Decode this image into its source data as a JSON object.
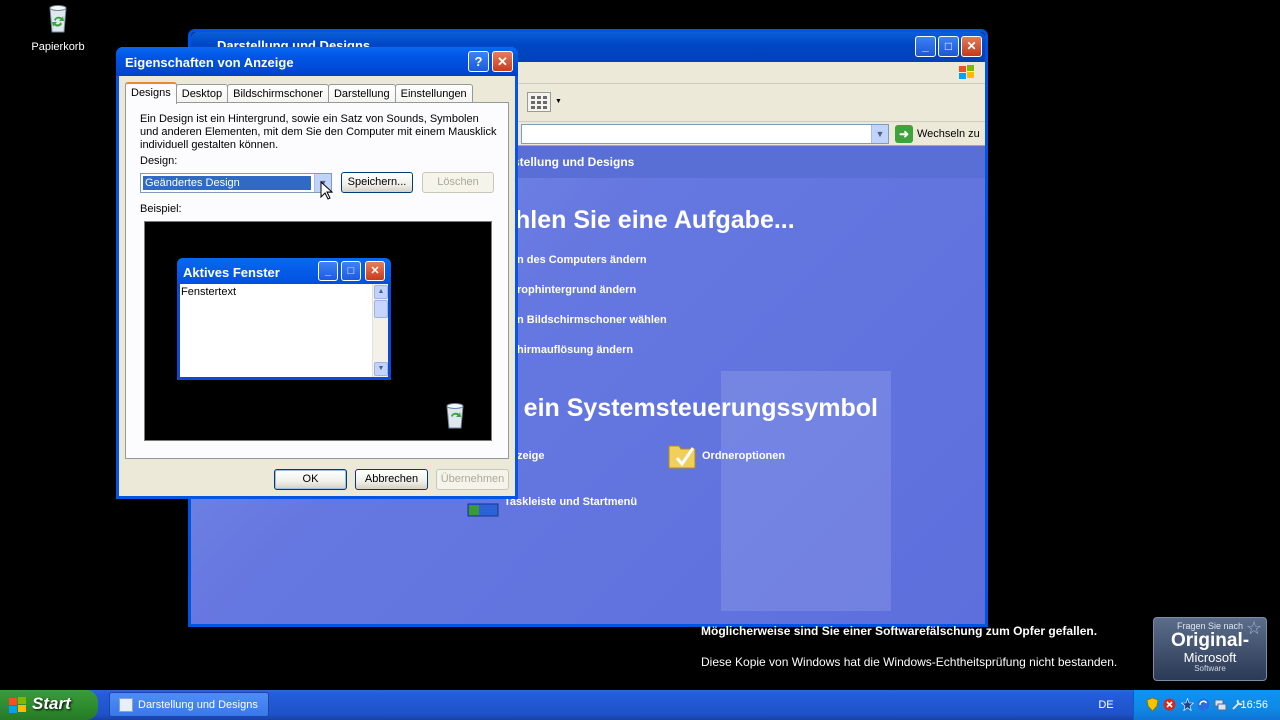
{
  "desktop": {
    "icons": [
      {
        "label": "Papierkorb",
        "icon": "recycle-bin-icon"
      }
    ]
  },
  "control_panel": {
    "title": "Darstellung und Designs",
    "address_go": "Wechseln zu",
    "breadcrumb": "stellung und Designs",
    "heading_tasks": "hlen Sie eine Aufgabe...",
    "tasks": [
      "n des Computers ändern",
      "rophintergrund ändern",
      "n Bildschirmschoner wählen",
      "hirmauflösung ändern"
    ],
    "heading_icons": "r ein Systemsteuerungssymbol",
    "icon_links": [
      "zeige",
      "Ordneroptionen",
      "Taskleiste und Startmenü"
    ]
  },
  "dialog": {
    "title": "Eigenschaften von Anzeige",
    "tabs": [
      "Designs",
      "Desktop",
      "Bildschirmschoner",
      "Darstellung",
      "Einstellungen"
    ],
    "active_tab": "Designs",
    "description": "Ein Design ist ein Hintergrund, sowie ein Satz von Sounds, Symbolen und anderen Elementen, mit dem Sie den Computer mit einem Mausklick individuell gestalten können.",
    "design_label": "Design:",
    "design_value": "Geändertes Design",
    "save_button": "Speichern...",
    "delete_button": "Löschen",
    "sample_label": "Beispiel:",
    "preview_window_title": "Aktives Fenster",
    "preview_window_text": "Fenstertext",
    "ok_button": "OK",
    "cancel_button": "Abbrechen",
    "apply_button": "Übernehmen"
  },
  "activation": {
    "line1": "Möglicherweise sind Sie einer Softwarefälschung zum Opfer gefallen.",
    "line2": "Diese Kopie von Windows hat die Windows-Echtheitsprüfung nicht bestanden.",
    "badge_line1": "Fragen Sie nach",
    "badge_line2": "Original-",
    "badge_line3": "Microsoft",
    "badge_line4": "Software"
  },
  "taskbar": {
    "start_label": "Start",
    "task_button": "Darstellung und Designs",
    "language": "DE",
    "clock": "16:56"
  },
  "colors": {
    "taskbar_blue": "#245edb",
    "start_green": "#3c9a3c",
    "titlebar_blue": "#0055e5",
    "control_panel_bg": "#6577e0"
  }
}
